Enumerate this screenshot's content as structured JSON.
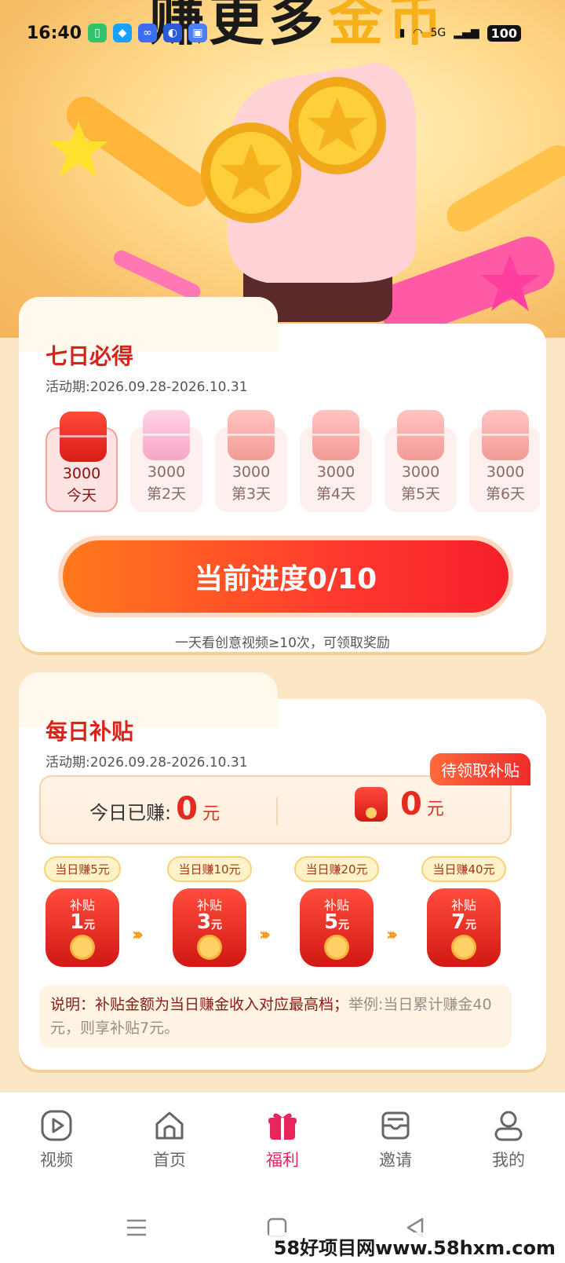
{
  "status_bar": {
    "time": "16:40",
    "network": "5G",
    "battery": "100"
  },
  "hero": {
    "title_dark": "赚更多",
    "title_gold": "金币"
  },
  "seven_day": {
    "title": "七日必得",
    "period": "活动期:2026.09.28-2026.10.31",
    "days": [
      {
        "amount": "3000",
        "label": "今天",
        "active": true
      },
      {
        "amount": "3000",
        "label": "第2天",
        "active": false
      },
      {
        "amount": "3000",
        "label": "第3天",
        "active": false
      },
      {
        "amount": "3000",
        "label": "第4天",
        "active": false
      },
      {
        "amount": "3000",
        "label": "第5天",
        "active": false
      },
      {
        "amount": "3000",
        "label": "第6天",
        "active": false
      }
    ],
    "progress_label": "当前进度0/10",
    "progress": {
      "current": 0,
      "total": 10
    },
    "tip": "一天看创意视频≥10次，可领取奖励"
  },
  "daily_subsidy": {
    "title": "每日补贴",
    "period": "活动期:2026.09.28-2026.10.31",
    "pending_tag": "待领取补贴",
    "earned_label": "今日已赚:",
    "earned_value": "0",
    "earned_unit": "元",
    "pending_value": "0",
    "pending_unit": "元",
    "tiers": [
      {
        "condition": "当日赚5元",
        "subsidy_label": "补贴",
        "amount": "1",
        "unit": "元"
      },
      {
        "condition": "当日赚10元",
        "subsidy_label": "补贴",
        "amount": "3",
        "unit": "元"
      },
      {
        "condition": "当日赚20元",
        "subsidy_label": "补贴",
        "amount": "5",
        "unit": "元"
      },
      {
        "condition": "当日赚40元",
        "subsidy_label": "补贴",
        "amount": "7",
        "unit": "元"
      }
    ],
    "note_main": "说明：补贴金额为当日赚金收入对应最高档；",
    "note_example": "举例:当日累计赚金40元，则享补贴7元。"
  },
  "bottom_nav": [
    {
      "label": "视频",
      "icon": "play-icon",
      "active": false
    },
    {
      "label": "首页",
      "icon": "home-icon",
      "active": false
    },
    {
      "label": "福利",
      "icon": "gift-icon",
      "active": true
    },
    {
      "label": "邀请",
      "icon": "envelope-icon",
      "active": false
    },
    {
      "label": "我的",
      "icon": "user-icon",
      "active": false
    }
  ],
  "watermark": "58好项目网www.58hxm.com",
  "colors": {
    "accent": "#e42b22",
    "nav_active": "#e8265e",
    "background": "#fbe6c5"
  }
}
